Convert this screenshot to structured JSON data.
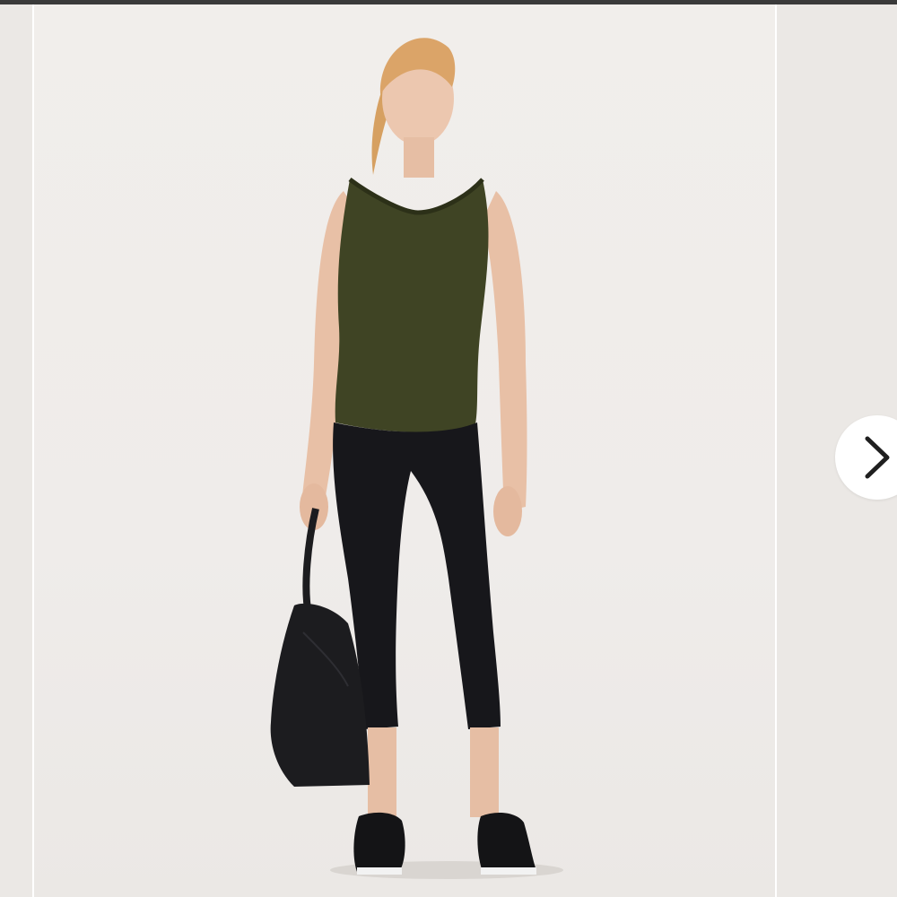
{
  "gallery": {
    "product_image": {
      "icon": "product-photo",
      "subject": "model-standing-full-length",
      "colors": {
        "background": "#efecea",
        "tank_top": "#3f4424",
        "leggings": "#17171b",
        "bag": "#1c1c1f",
        "skin": "#e8c2aa",
        "hair": "#d9a56a"
      }
    },
    "next_button": {
      "icon": "chevron-right-icon"
    }
  }
}
